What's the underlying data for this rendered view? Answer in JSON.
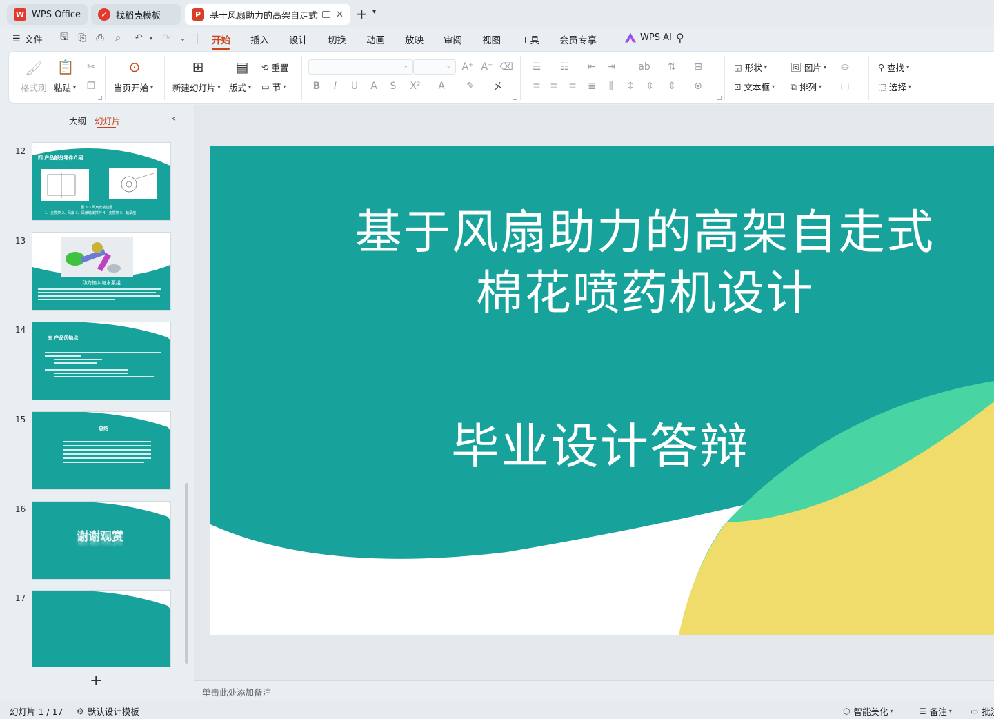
{
  "tabs": [
    {
      "label": "WPS Office",
      "icon": "wps-logo-icon"
    },
    {
      "label": "找稻壳模板",
      "icon": "daoke-logo-icon"
    },
    {
      "label": "基于风扇助力的高架自走式棉",
      "icon": "ppt-logo-icon"
    }
  ],
  "menu": {
    "file": "文件",
    "items": [
      "开始",
      "插入",
      "设计",
      "切换",
      "动画",
      "放映",
      "审阅",
      "视图",
      "工具",
      "会员专享"
    ],
    "active": "开始",
    "ai": "WPS AI"
  },
  "ribbon": {
    "format_painter": "格式刷",
    "paste": "粘贴",
    "play_from_current": "当页开始",
    "new_slide": "新建幻灯片",
    "layout": "版式",
    "reset": "重置",
    "section": "节",
    "shape": "形状",
    "picture": "图片",
    "textbox": "文本框",
    "arrange": "排列",
    "find": "查找",
    "select": "选择"
  },
  "left_panel": {
    "tab_outline": "大纲",
    "tab_slides": "幻灯片",
    "thumbnails": [
      {
        "num": "12",
        "title": "四  产品部分零件介绍",
        "caption": "图 3-3 风扇安装位图",
        "caption2": "1、支撑架 2、风扇 3、风扇轴支撑杆 4、支撑架 5、轴承座"
      },
      {
        "num": "13",
        "title": "动力输入与水泵组"
      },
      {
        "num": "14",
        "title": "五  产品优缺点"
      },
      {
        "num": "15",
        "title": "总结"
      },
      {
        "num": "16",
        "title": "谢谢观赏"
      },
      {
        "num": "17",
        "title": ""
      }
    ]
  },
  "slide": {
    "title_line1": "基于风扇助力的高架自走式",
    "title_line2": "棉花喷药机设计",
    "subtitle": "毕业设计答辩",
    "colors": {
      "teal": "#17a29b",
      "green": "#48d4a3",
      "yellow": "#f0dc6a"
    }
  },
  "notes": {
    "placeholder": "单击此处添加备注"
  },
  "status": {
    "slide_counter": "幻灯片 1 / 17",
    "template": "默认设计模板",
    "beautify": "智能美化",
    "notes": "备注",
    "comments": "批注"
  }
}
